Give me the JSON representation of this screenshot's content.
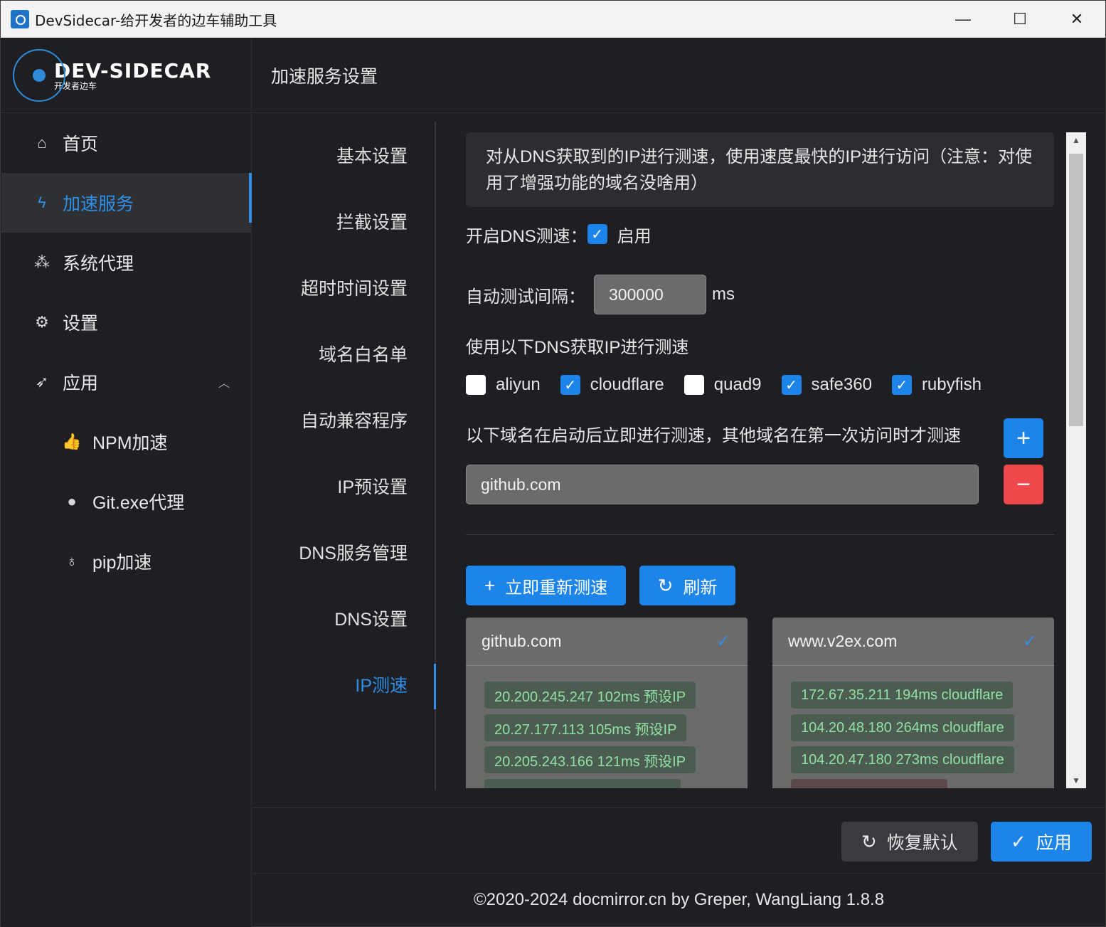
{
  "window": {
    "title": "DevSidecar-给开发者的边车辅助工具",
    "controls": {
      "minimize": "—",
      "maximize": "☐",
      "close": "✕"
    }
  },
  "logo": {
    "main": "DEV-SIDECAR",
    "sub": "开发者边车"
  },
  "sidebar": {
    "items": [
      {
        "label": "首页",
        "icon": "home-icon",
        "glyph": "⌂"
      },
      {
        "label": "加速服务",
        "icon": "lightning-icon",
        "glyph": "ϟ"
      },
      {
        "label": "系统代理",
        "icon": "network-icon",
        "glyph": "⁂"
      },
      {
        "label": "设置",
        "icon": "gear-icon",
        "glyph": "⚙"
      },
      {
        "label": "应用",
        "icon": "rocket-icon",
        "glyph": "➶"
      },
      {
        "label": "NPM加速",
        "icon": "thumbs-up-icon",
        "glyph": "👍"
      },
      {
        "label": "Git.exe代理",
        "icon": "github-icon",
        "glyph": "●"
      },
      {
        "label": "pip加速",
        "icon": "bulb-icon",
        "glyph": "♁"
      }
    ]
  },
  "header": {
    "title": "加速服务设置"
  },
  "tabs": [
    "基本设置",
    "拦截设置",
    "超时时间设置",
    "域名白名单",
    "自动兼容程序",
    "IP预设置",
    "DNS服务管理",
    "DNS设置",
    "IP测速"
  ],
  "speedtest": {
    "notice": "对从DNS获取到的IP进行测速，使用速度最快的IP进行访问（注意：对使用了增强功能的域名没啥用）",
    "enable_label": "开启DNS测速：",
    "enable_text": "启用",
    "enabled": true,
    "interval_label": "自动测试间隔：",
    "interval_value": "300000",
    "interval_unit": "ms",
    "dns_label": "使用以下DNS获取IP进行测速",
    "dns_options": [
      {
        "name": "aliyun",
        "checked": false
      },
      {
        "name": "cloudflare",
        "checked": true
      },
      {
        "name": "quad9",
        "checked": false
      },
      {
        "name": "safe360",
        "checked": true
      },
      {
        "name": "rubyfish",
        "checked": true
      }
    ],
    "domains_label": "以下域名在启动后立即进行测速，其他域名在第一次访问时才测速",
    "domain_value": "github.com",
    "retest_button": "立即重新测速",
    "refresh_button": "刷新",
    "results": [
      {
        "domain": "github.com",
        "ips": [
          "20.200.245.247 102ms 预设IP",
          "20.27.177.113 105ms 预设IP",
          "20.205.243.166 121ms 预设IP"
        ]
      },
      {
        "domain": "www.v2ex.com",
        "ips": [
          "172.67.35.211 194ms cloudflare",
          "104.20.48.180 264ms cloudflare",
          "104.20.47.180 273ms cloudflare"
        ]
      }
    ]
  },
  "actions": {
    "reset": "恢复默认",
    "apply": "应用"
  },
  "footer": {
    "copyright": "©2020-2024 docmirror.cn by Greper, WangLiang 1.8.8"
  },
  "colors": {
    "accent": "#1d84ea",
    "danger": "#f0474c",
    "background": "#1e1f22",
    "tag_text": "#8fe0a4"
  }
}
